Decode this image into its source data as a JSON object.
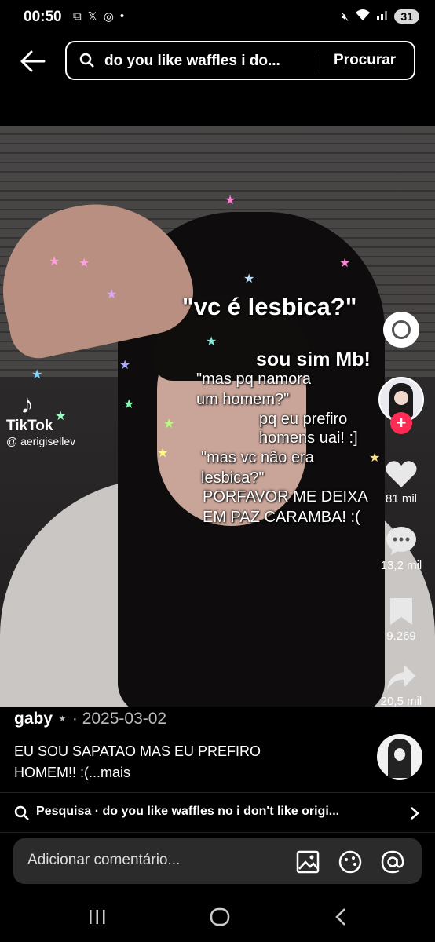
{
  "status": {
    "time": "00:50",
    "battery": "31"
  },
  "search": {
    "query": "do you like waffles i do...",
    "submit": "Procurar"
  },
  "overlay": {
    "line1": "\"vc é lesbica?\"",
    "line2": "sou sim Mb!",
    "line3a": "\"mas pq namora",
    "line3b": "um homem?\"",
    "line4a": "pq eu prefiro",
    "line4b": "homens uai! :]",
    "line5a": "\"mas vc não era",
    "line5b": "lesbica?\"",
    "line6a": "PORFAVOR ME DEIXA",
    "line6b": "EM PAZ CARAMBA! :("
  },
  "watermark": {
    "brand": "TikTok",
    "handle": "@ aerigisellev"
  },
  "actions": {
    "likes": "81 mil",
    "comments": "13,2 mil",
    "saves": "9.269",
    "shares": "20,5 mil"
  },
  "post": {
    "username": "gaby",
    "separator": "⋆ ·",
    "date": "2025-03-02",
    "caption_line1": "EU SOU SAPATAO MAS EU PREFIRO",
    "caption_line2": "HOMEM!!  :(...mais"
  },
  "related": {
    "text": "Pesquisa · do you like waffles no i don't like origi..."
  },
  "comment": {
    "placeholder": "Adicionar comentário..."
  },
  "colors": {
    "accent_red": "#fe2c55",
    "bg": "#000000"
  }
}
